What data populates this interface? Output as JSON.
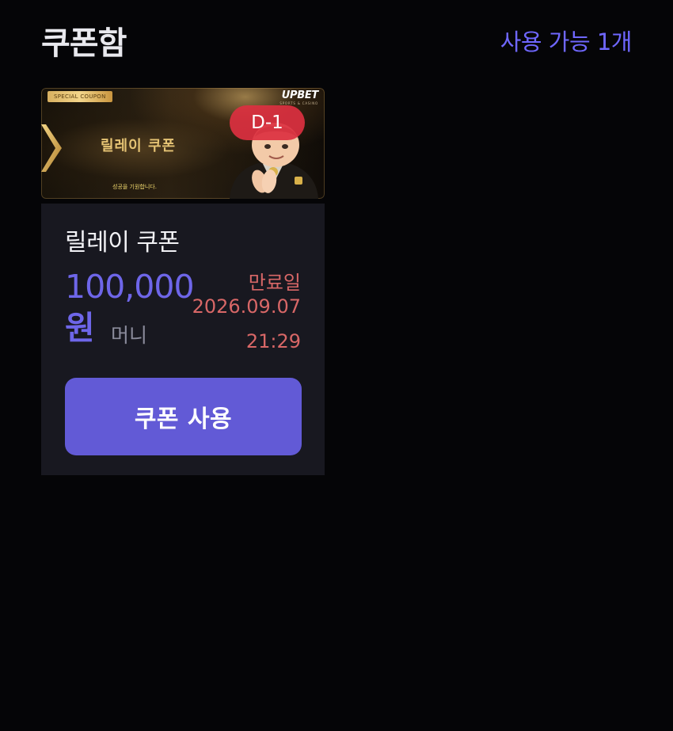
{
  "header": {
    "title": "쿠폰함",
    "available_count": "사용 가능 1개"
  },
  "coupon": {
    "banner": {
      "tag": "SPECIAL COUPON",
      "logo": "UPBET",
      "logo_sub": "SPORTS & CASINO",
      "title": "릴레이 쿠폰",
      "subtext": "성공을 기원합니다.",
      "dday_badge": "D-1",
      "mascot_icon": "mascot-character-icon",
      "accent_color": "#e5c374"
    },
    "name": "릴레이 쿠폰",
    "amount": "100,000",
    "currency": "원",
    "money_type": "머니",
    "expiry_label": "만료일",
    "expiry_date": "2026.09.07",
    "expiry_time": "21:29",
    "use_button_label": "쿠폰 사용"
  },
  "colors": {
    "background": "#050507",
    "card_body": "#181820",
    "accent_purple": "#6e66e9",
    "button": "#625ad6",
    "expiry_red": "#d86767",
    "badge_red": "#dc3040"
  }
}
